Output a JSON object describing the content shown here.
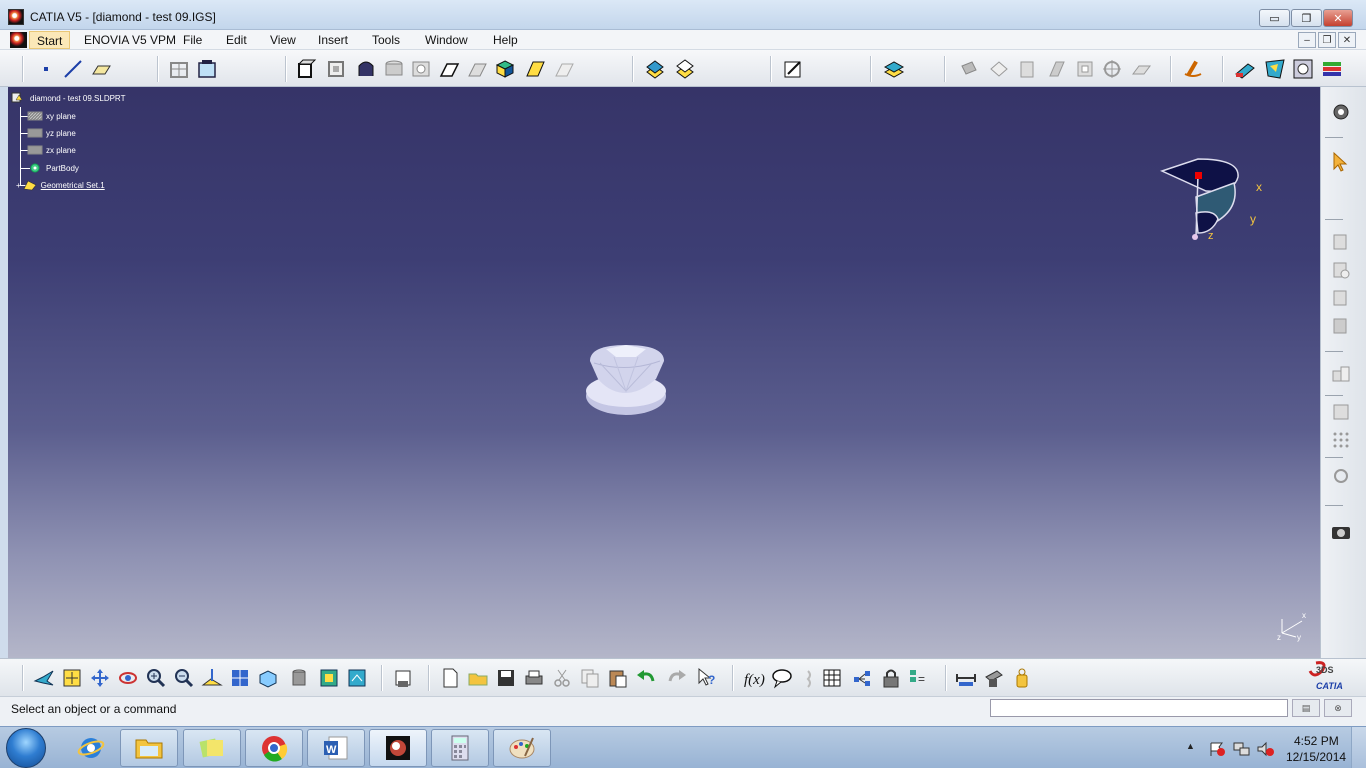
{
  "window": {
    "title": "CATIA V5 - [diamond - test 09.IGS]",
    "buttons": {
      "minimize": "▭",
      "restore": "❐",
      "close": "✕"
    }
  },
  "menu": {
    "items": [
      "Start",
      "ENOVIA V5 VPM",
      "File",
      "Edit",
      "View",
      "Insert",
      "Tools",
      "Window",
      "Help"
    ]
  },
  "tree": {
    "root": "diamond - test 09.SLDPRT",
    "children": [
      "xy plane",
      "yz plane",
      "zx plane",
      "PartBody",
      "Geometrical Set.1"
    ]
  },
  "compass": {
    "x_label": "x",
    "y_label": "y",
    "z_label": "z"
  },
  "axis_triad": {
    "x": "x",
    "y": "y",
    "z": "z"
  },
  "status": {
    "message": "Select an object or a command",
    "command_input_value": ""
  },
  "brand": {
    "logo_text": "CATIA",
    "logo_mark": "3DS"
  },
  "taskbar": {
    "time": "4:52 PM",
    "date": "12/15/2014"
  },
  "colors": {
    "viewport_top": "#363468",
    "viewport_bottom": "#b4b6c9",
    "start_highlight": "#fbe8b8"
  }
}
